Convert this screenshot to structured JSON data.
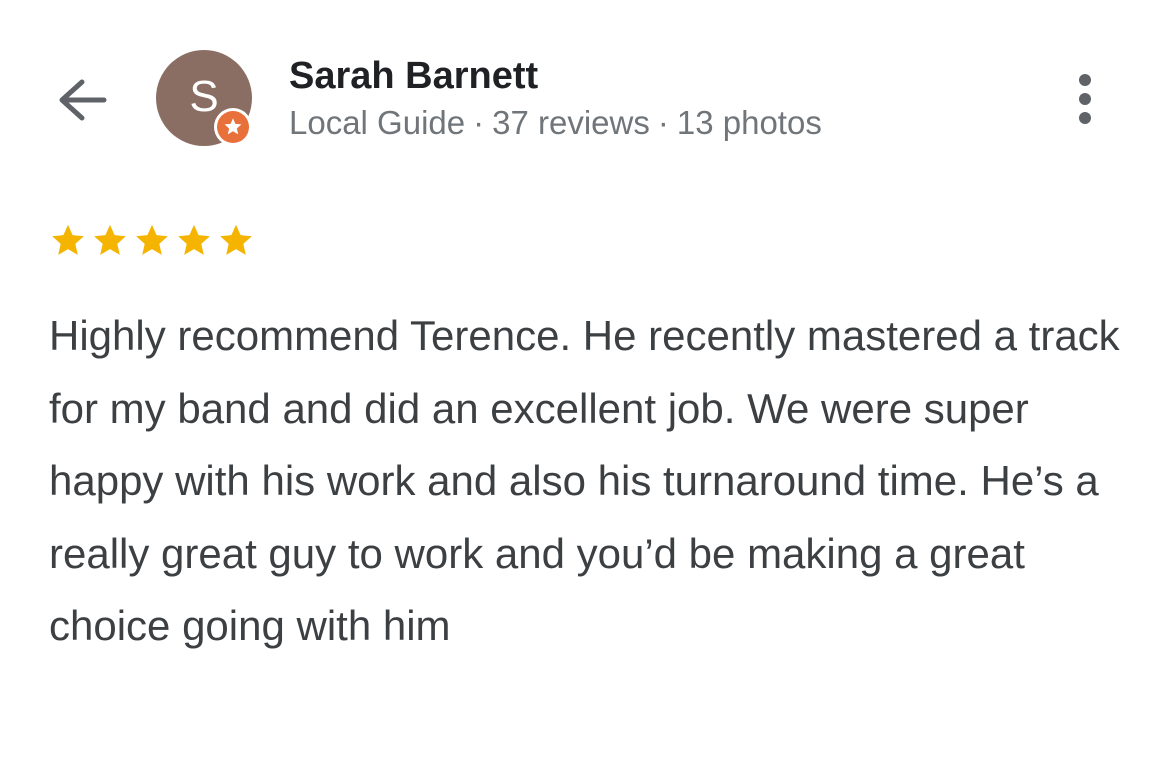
{
  "reviewer": {
    "name": "Sarah Barnett",
    "avatar_initial": "S",
    "avatar_color": "#8b6e63",
    "badge_icon": "local-guide-star-icon",
    "badge_color": "#e8703a",
    "level": "Local Guide",
    "reviews": "37 reviews",
    "photos": "13 photos",
    "separator": "·"
  },
  "review": {
    "rating": 5,
    "max_rating": 5,
    "star_color": "#f4b400",
    "text": "Highly recommend Terence. He recently mastered a track for my band and did an excellent job. We were super happy with his work and also his turnaround time. He’s a really great guy to work and you’d be making a great choice going with him"
  },
  "icons": {
    "back": "arrow-back-icon",
    "more": "more-vert-icon",
    "star": "star-icon"
  }
}
